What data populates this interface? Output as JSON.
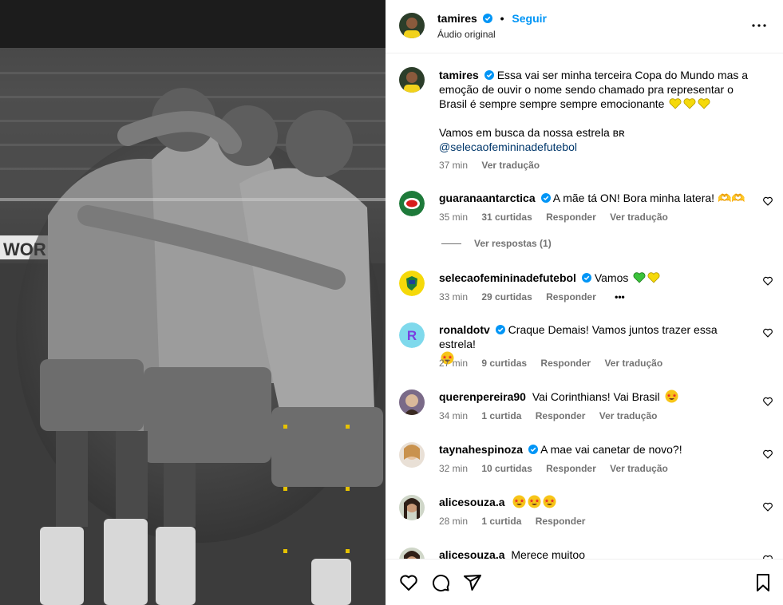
{
  "post": {
    "author": "tamires",
    "follow_label": "Seguir",
    "audio_label": "Áudio original",
    "caption_text": "Essa vai ser minha terceira Copa do Mundo mas a emoção de ouvir o nome sendo chamado pra representar o Brasil é sempre sempre sempre emocionante",
    "caption_line2": "Vamos em busca da nossa estrela ʙʀ",
    "caption_mention": "@selecaofemininadefutebol",
    "time": "37 min",
    "translate_label": "Ver tradução"
  },
  "comments": [
    {
      "username": "guaranaantarctica",
      "verified": true,
      "text": "A mãe tá ON! Bora minha latera! 🫶🫶",
      "time": "35 min",
      "likes": "31 curtidas",
      "reply": "Responder",
      "translate": "Ver tradução",
      "replies_label": "Ver respostas (1)"
    },
    {
      "username": "selecaofemininadefutebol",
      "verified": true,
      "text": "Vamos",
      "time": "33 min",
      "likes": "29 curtidas",
      "reply": "Responder",
      "more": "•••"
    },
    {
      "username": "ronaldotv",
      "verified": true,
      "text": "Craque Demais! Vamos juntos trazer essa estrela!",
      "time": "27 min",
      "likes": "9 curtidas",
      "reply": "Responder",
      "translate": "Ver tradução"
    },
    {
      "username": "querenpereira90",
      "verified": false,
      "text": "Vai Corinthians! Vai Brasil",
      "time": "34 min",
      "likes": "1 curtida",
      "reply": "Responder",
      "translate": "Ver tradução"
    },
    {
      "username": "taynahespinoza",
      "verified": true,
      "text": "A mae vai canetar de novo?!",
      "time": "32 min",
      "likes": "10 curtidas",
      "reply": "Responder",
      "translate": "Ver tradução"
    },
    {
      "username": "alicesouza.a",
      "verified": false,
      "text": "",
      "time": "28 min",
      "likes": "1 curtida",
      "reply": "Responder"
    },
    {
      "username": "alicesouza.a",
      "verified": false,
      "text": "Merece muitoo"
    }
  ],
  "colors": {
    "accent": "#0095f6",
    "verified": "#0095f6",
    "muted": "#737373",
    "mention": "#00376b"
  },
  "icons": {
    "more": "more-horizontal-icon",
    "like": "heart-icon",
    "comment": "comment-icon",
    "share": "send-icon",
    "save": "bookmark-icon"
  }
}
